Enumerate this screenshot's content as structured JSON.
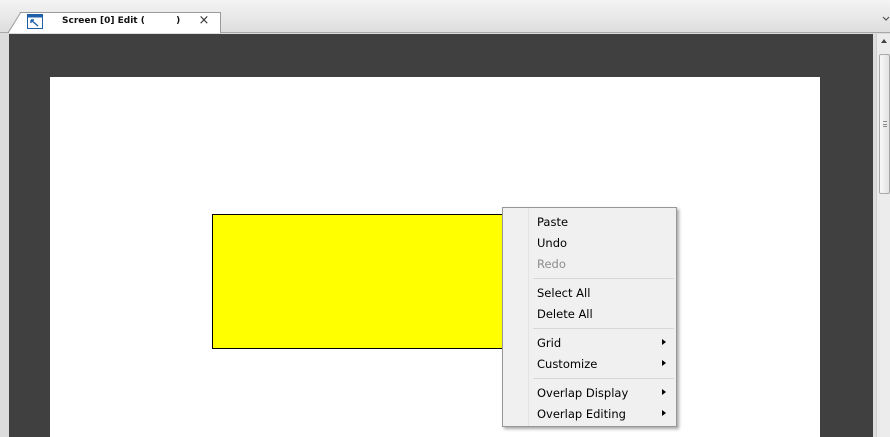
{
  "tab": {
    "title": "Screen [0] Edit (          )",
    "close_glyph": "×",
    "icon": "screen-edit-icon"
  },
  "canvas": {
    "background": "#ffffff",
    "workspace_color": "#404040",
    "object_fill": "#ffff00"
  },
  "context_menu": {
    "groups": [
      [
        {
          "label": "Paste",
          "enabled": true,
          "submenu": false
        },
        {
          "label": "Undo",
          "enabled": true,
          "submenu": false
        },
        {
          "label": "Redo",
          "enabled": false,
          "submenu": false
        }
      ],
      [
        {
          "label": "Select All",
          "enabled": true,
          "submenu": false
        },
        {
          "label": "Delete All",
          "enabled": true,
          "submenu": false
        }
      ],
      [
        {
          "label": "Grid",
          "enabled": true,
          "submenu": true
        },
        {
          "label": "Customize",
          "enabled": true,
          "submenu": true
        }
      ],
      [
        {
          "label": "Overlap Display",
          "enabled": true,
          "submenu": true
        },
        {
          "label": "Overlap Editing",
          "enabled": true,
          "submenu": true
        }
      ]
    ]
  }
}
